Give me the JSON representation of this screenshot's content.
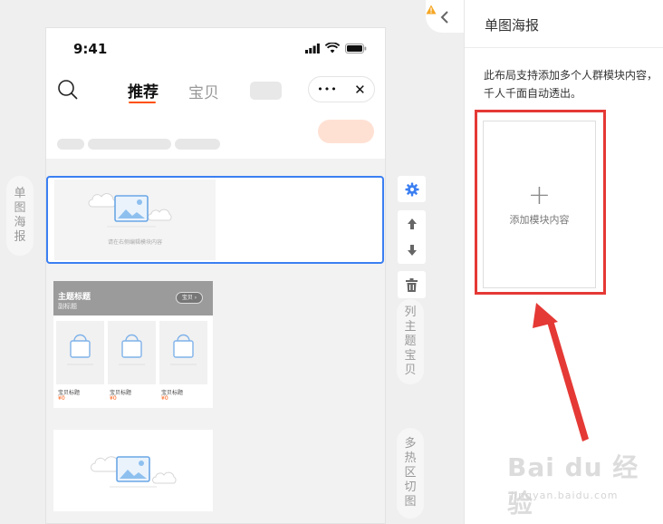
{
  "canvas_tabs": {
    "left_single_poster": [
      "单",
      "图",
      "海",
      "报"
    ],
    "series_theme_items": [
      "列",
      "主",
      "题",
      "宝",
      "贝"
    ],
    "multi_hotspot": [
      "多",
      "热",
      "区",
      "切",
      "图"
    ]
  },
  "phone": {
    "time": "9:41",
    "nav": {
      "tab_recommend": "推荐",
      "tab_baby": "宝贝",
      "capsule_more": "•••",
      "capsule_close": "✕"
    },
    "selected_module_caption": "请在右侧编辑模块内容",
    "theme_card": {
      "title": "主题标题",
      "subtitle": "副标题",
      "button": "宝贝 ›",
      "products": [
        {
          "title": "宝贝标题",
          "price": "¥0"
        },
        {
          "title": "宝贝标题",
          "price": "¥0"
        },
        {
          "title": "宝贝标题",
          "price": "¥0"
        }
      ]
    }
  },
  "toolbar": {
    "settings_icon": "gear-icon",
    "move_up_icon": "arrow-up-icon",
    "move_down_icon": "arrow-down-icon",
    "delete_icon": "trash-icon"
  },
  "panel": {
    "title": "单图海报",
    "description_line1": "此布局支持添加多个人群模块内容，",
    "description_line2": "千人千面自动透出。",
    "add_plus": "+",
    "add_label": "添加模块内容"
  },
  "watermark": {
    "main": "Bai du 经验",
    "sub": "jingyan.baidu.com"
  },
  "colors": {
    "accent_blue": "#3b7ff2",
    "accent_orange": "#ff5000",
    "highlight_red": "#e53935",
    "arrow_red": "#e53935"
  }
}
